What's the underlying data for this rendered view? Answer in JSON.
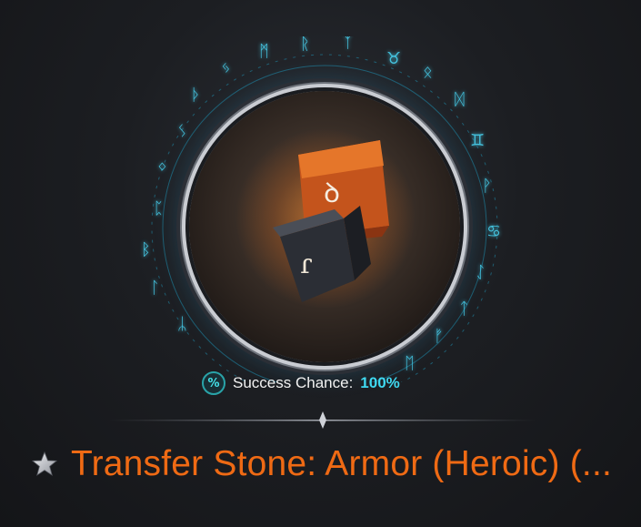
{
  "item": {
    "name": "Transfer Stone: Armor (Heroic) (...",
    "rarity_color": "#ef6a14",
    "icon": "transfer-stone-icon",
    "rune_glyphs": [
      "ꝺ",
      "ɾ"
    ]
  },
  "success": {
    "badge": "%",
    "label": "Success Chance:",
    "value": "100%",
    "value_color": "#3fd8f0"
  },
  "star": {
    "icon": "star-icon"
  }
}
